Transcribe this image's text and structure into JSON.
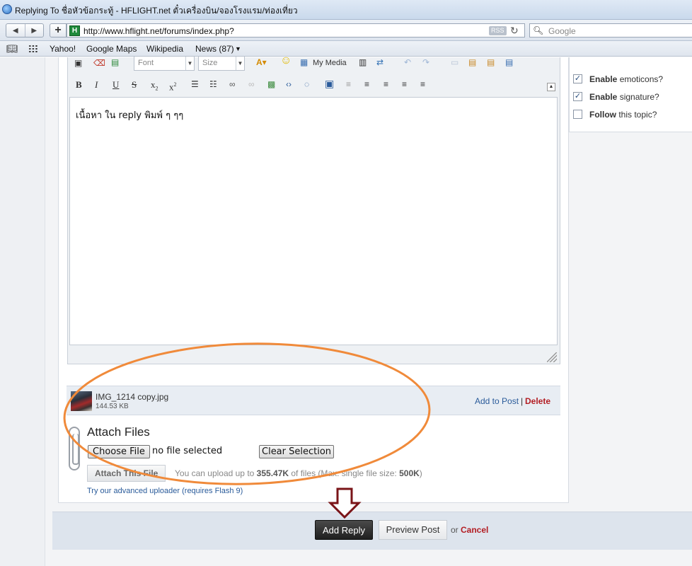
{
  "browser": {
    "title": "Replying To ชื่อหัวข้อกระทู้ - HFLIGHT.net ตั๋วเครื่องบิน/จองโรงแรม/ท่องเที่ยว",
    "url": "http://www.hflight.net/forums/index.php?",
    "rss_label": "RSS",
    "search_placeholder": "Google",
    "bookmarks": [
      "Yahoo!",
      "Google Maps",
      "Wikipedia",
      "News (87)"
    ]
  },
  "editor": {
    "font_select": "Font",
    "size_select": "Size",
    "my_media": "My Media",
    "content": "เนื้อหา ใน reply พิมพ์ ๆ ๆๆ"
  },
  "options": {
    "enable_emoticons": {
      "bold": "Enable",
      "rest": " emoticons?",
      "checked": true
    },
    "enable_signature": {
      "bold": "Enable",
      "rest": " signature?",
      "checked": true
    },
    "follow_topic": {
      "bold": "Follow",
      "rest": " this topic?",
      "checked": false
    }
  },
  "attachment": {
    "file_name": "IMG_1214 copy.jpg",
    "file_size": "144.53 KB",
    "add_to_post": "Add to Post",
    "separator": "|",
    "delete": "Delete"
  },
  "attach_files": {
    "title": "Attach Files",
    "choose_file": "Choose File",
    "no_file": "no file selected",
    "clear_selection": "Clear Selection",
    "attach_this_file": "Attach This File",
    "note_prefix": "You can upload up to ",
    "note_quota": "355.47K",
    "note_middle": " of files (Max. single file size: ",
    "note_max": "500K",
    "note_suffix": ")",
    "advanced_link": "Try our advanced uploader (requires Flash 9)"
  },
  "actions": {
    "add_reply": "Add Reply",
    "preview_post": "Preview Post",
    "or": "or",
    "cancel": "Cancel"
  },
  "colors": {
    "annotation_ellipse": "#f08a3a",
    "annotation_arrow": "#7a1418",
    "link": "#2a5b9a",
    "danger": "#b31d23"
  }
}
